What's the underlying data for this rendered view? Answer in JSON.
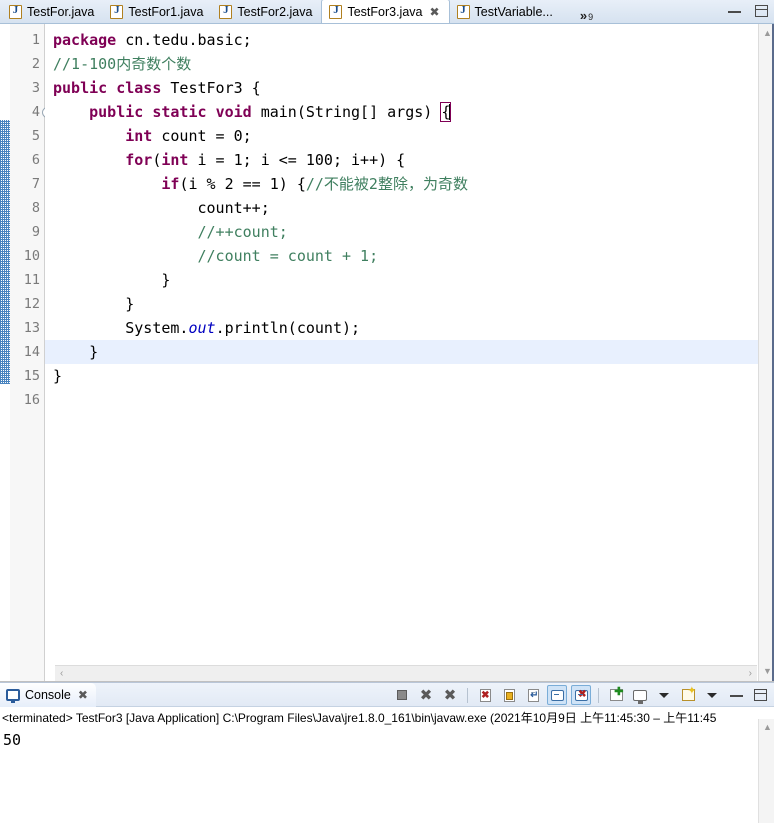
{
  "editor_tabs": {
    "tabs": [
      {
        "label": "TestFor.java",
        "icon": "java-file-icon",
        "active": false,
        "closable": false
      },
      {
        "label": "TestFor1.java",
        "icon": "java-file-icon",
        "active": false,
        "closable": false
      },
      {
        "label": "TestFor2.java",
        "icon": "java-file-icon",
        "active": false,
        "closable": false
      },
      {
        "label": "TestFor3.java",
        "icon": "java-file-icon",
        "active": true,
        "closable": true
      },
      {
        "label": "TestVariable...",
        "icon": "java-file-icon",
        "active": false,
        "closable": false
      }
    ],
    "overflow_symbol": "»",
    "overflow_count": "9",
    "minimize_label": "Minimize",
    "maximize_label": "Maximize"
  },
  "editor": {
    "line_numbers": [
      "1",
      "2",
      "3",
      "4",
      "5",
      "6",
      "7",
      "8",
      "9",
      "10",
      "11",
      "12",
      "13",
      "14",
      "15",
      "16"
    ],
    "fold_marker_line": "4",
    "highlighted_line": "14",
    "caret_line": "4",
    "code_lines": [
      "package cn.tedu.basic;",
      "//1-100内奇数个数",
      "public class TestFor3 {",
      "    public static void main(String[] args) {",
      "        int count = 0;",
      "        for(int i = 1; i <= 100; i++) {",
      "            if(i % 2 == 1) {//不能被2整除，为奇数",
      "                count++;",
      "                //++count;",
      "                //count = count + 1;",
      "            }",
      "        }",
      "        System.out.println(count);",
      "    }",
      "}",
      ""
    ],
    "scroll_left_arrow": "‹",
    "scroll_right_arrow": "›",
    "scroll_up_arrow": "▲",
    "scroll_down_arrow": "▼"
  },
  "console": {
    "tab_label": "Console",
    "tab_icon": "console-monitor-icon",
    "tab_close": "✖",
    "toolbar": [
      {
        "name": "terminate-button",
        "icon": "stop-square-icon",
        "pressed": false
      },
      {
        "name": "remove-launch-button",
        "icon": "x-mark-icon",
        "pressed": false
      },
      {
        "name": "remove-all-terminated-button",
        "icon": "x-mark-multiple-icon",
        "pressed": false
      },
      {
        "name": "clear-console-button",
        "icon": "clear-console-icon",
        "pressed": false
      },
      {
        "name": "scroll-lock-button",
        "icon": "scroll-lock-icon",
        "pressed": false
      },
      {
        "name": "word-wrap-button",
        "icon": "word-wrap-icon",
        "pressed": false
      },
      {
        "name": "show-console-on-output-button",
        "icon": "console-output-icon",
        "pressed": true
      },
      {
        "name": "show-console-on-error-button",
        "icon": "console-error-icon",
        "pressed": true
      },
      {
        "name": "pin-console-button",
        "icon": "pin-console-icon",
        "pressed": false
      },
      {
        "name": "display-selected-console-button",
        "icon": "display-console-icon",
        "pressed": false
      },
      {
        "name": "open-console-button",
        "icon": "open-console-icon",
        "pressed": false
      }
    ],
    "minimize_label": "Minimize",
    "maximize_label": "Maximize",
    "status_line": "<terminated> TestFor3 [Java Application] C:\\Program Files\\Java\\jre1.8.0_161\\bin\\javaw.exe (2021年10月9日 上午11:45:30 – 上午11:45",
    "output": "50",
    "scroll_up_arrow": "▲"
  },
  "colors": {
    "keyword": "#7f0055",
    "comment": "#3f7f5f",
    "static_field": "#0000c0",
    "highlight_line": "#e8f0fe",
    "tab_active_bg": "#ffffff",
    "marker_blue": "#2a6fb5",
    "toolbar_pressed": "#cfe3f7"
  }
}
